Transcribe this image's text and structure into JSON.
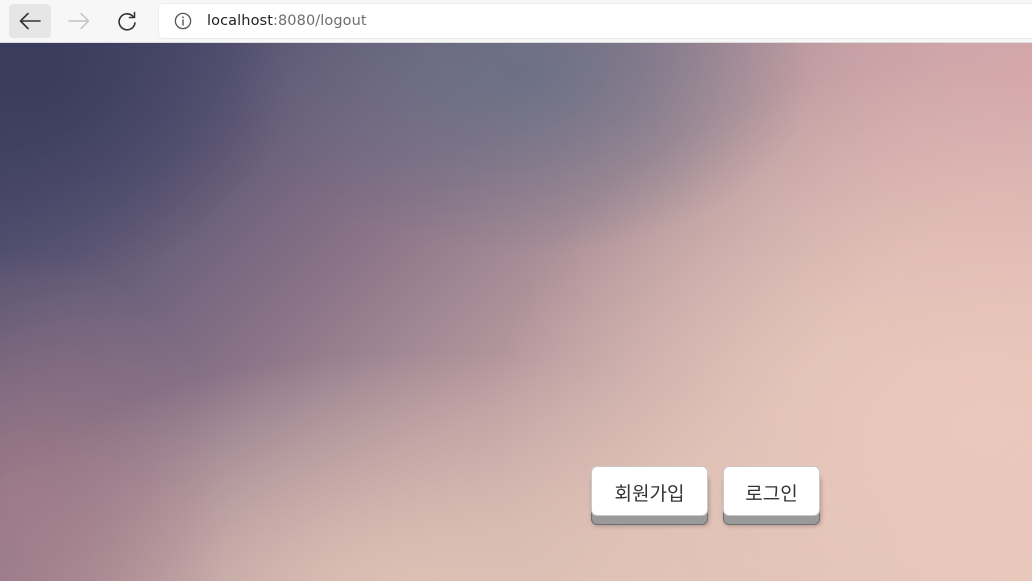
{
  "browser": {
    "url_host": "localhost",
    "url_rest": ":8080/logout",
    "icons": {
      "back": "arrow-left-icon",
      "forward": "arrow-right-icon",
      "reload": "reload-icon",
      "site_info": "info-icon"
    }
  },
  "page": {
    "signup_label": "회원가입",
    "login_label": "로그인"
  },
  "colors": {
    "gradient_dark": "#3f3f62",
    "gradient_light": "#e6c7bc",
    "button_bg": "#ffffff",
    "button_text": "#333333"
  }
}
